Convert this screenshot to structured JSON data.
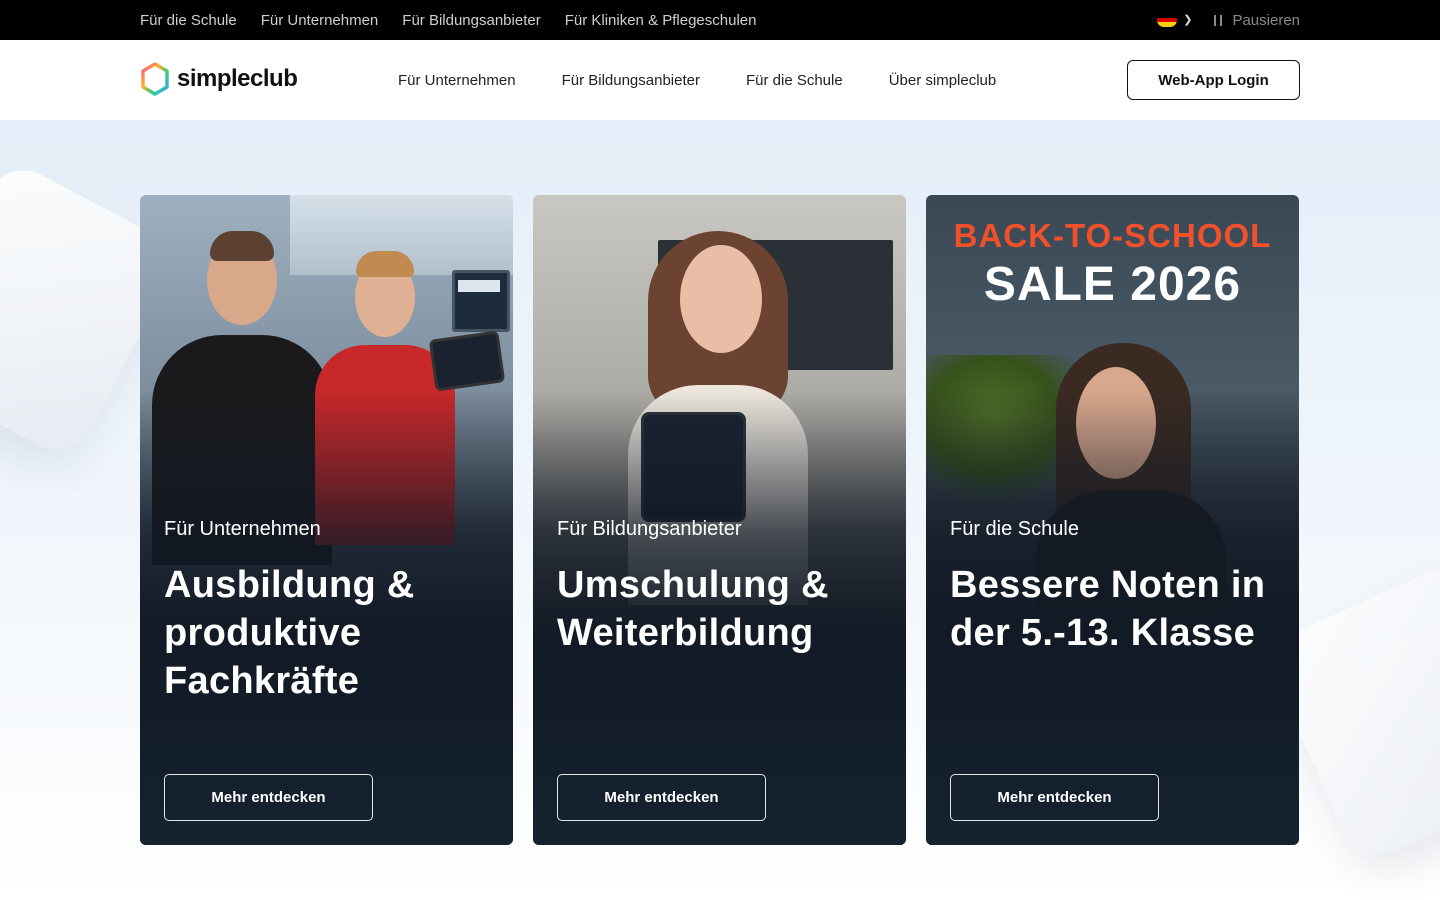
{
  "topbar": {
    "links": [
      "Für die Schule",
      "Für Unternehmen",
      "Für Bildungsanbieter",
      "Für Kliniken & Pflegeschulen"
    ],
    "pause_label": "Pausieren",
    "language_flag": "germany-flag-icon"
  },
  "nav": {
    "logo_text": "simpleclub",
    "links": [
      "Für Unternehmen",
      "Für Bildungsanbieter",
      "Für die Schule",
      "Über simpleclub"
    ],
    "login_label": "Web-App Login"
  },
  "cards": [
    {
      "eyebrow": "Für Unternehmen",
      "heading": "Ausbildung & produktive Fachkräfte",
      "button": "Mehr entdecken"
    },
    {
      "eyebrow": "Für Bildungsanbieter",
      "heading": "Umschulung & Weiterbildung",
      "button": "Mehr entdecken"
    },
    {
      "eyebrow": "Für die Schule",
      "heading": "Bessere Noten in der 5.-13. Klasse",
      "button": "Mehr entdecken",
      "promo_line1": "BACK-TO-SCHOOL",
      "promo_line2": "SALE 2026"
    }
  ],
  "colors": {
    "topbar_bg": "#000000",
    "promo_accent": "#f0502a",
    "card_dark": "#111a25",
    "hero_bg": "#e4eff9"
  }
}
